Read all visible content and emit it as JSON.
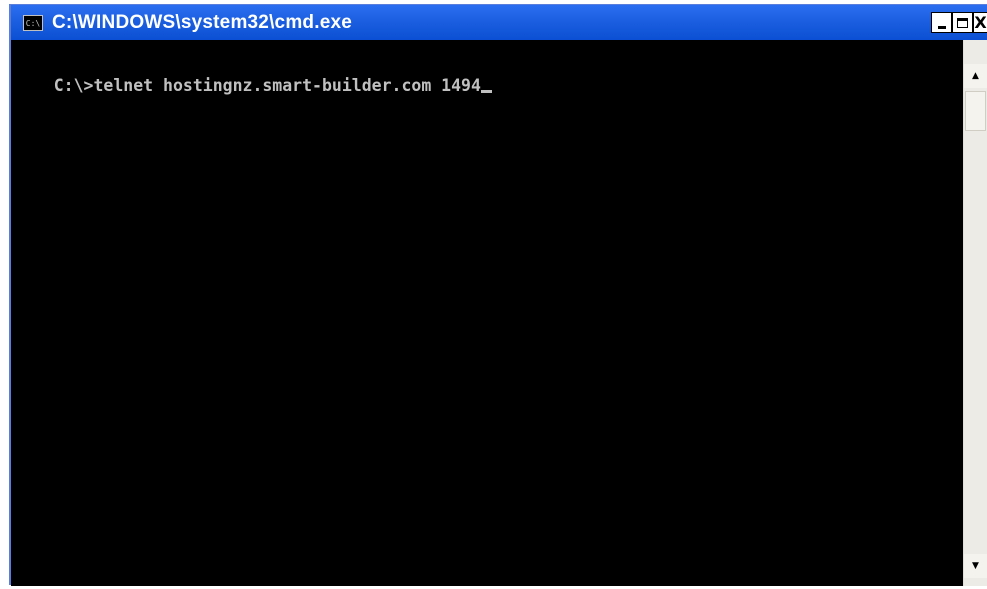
{
  "window": {
    "title": "C:\\WINDOWS\\system32\\cmd.exe",
    "icon_name": "cmd-app-icon",
    "icon_text": "C:\\",
    "minimize_icon": "minimize-icon",
    "maximize_icon": "maximize-icon",
    "close_label": "X"
  },
  "console": {
    "prompt": "C:\\>",
    "command": "telnet hostingnz.smart-builder.com 1494",
    "text_color": "#c0c0c0",
    "background": "#000000"
  },
  "scrollbar": {
    "up_arrow": "▲",
    "down_arrow": "▼"
  }
}
